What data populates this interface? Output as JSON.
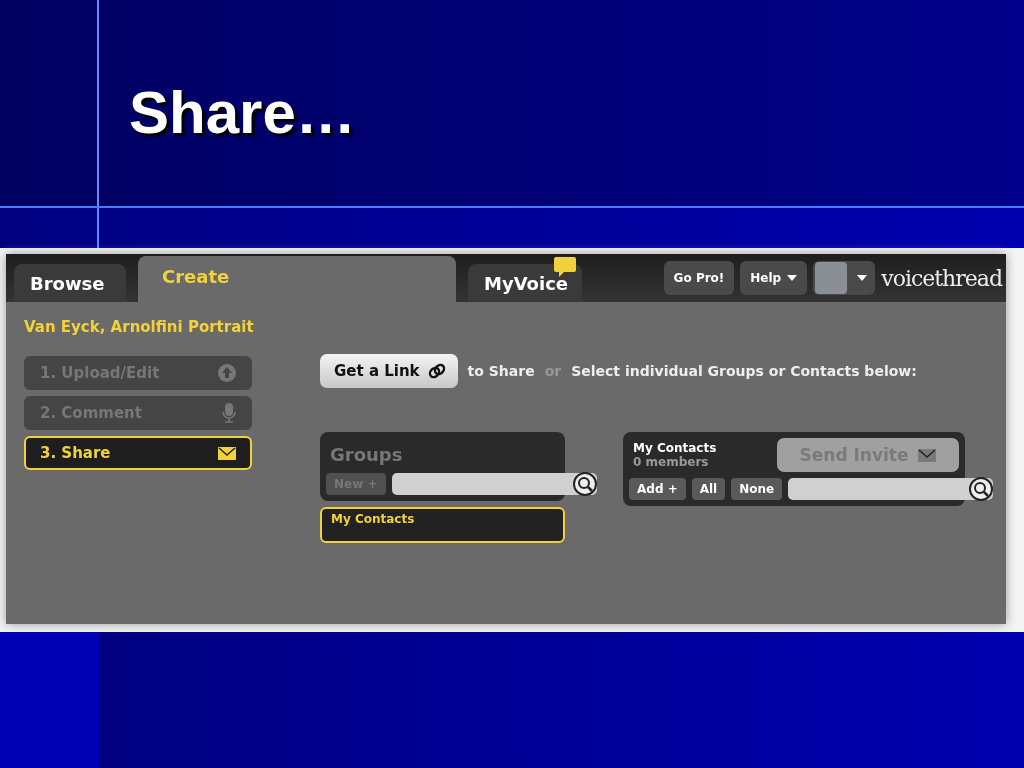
{
  "slide": {
    "title": "Share…"
  },
  "app": {
    "tabs": [
      {
        "label": "Browse",
        "selected": false,
        "notification": false
      },
      {
        "label": "Create",
        "selected": true,
        "notification": false
      },
      {
        "label": "MyVoice",
        "selected": false,
        "notification": true
      }
    ],
    "header_buttons": [
      {
        "label": "Go Pro!",
        "dropdown": false
      },
      {
        "label": "Help",
        "dropdown": true
      }
    ],
    "logo": "voicethread",
    "project_title": "Van Eyck, Arnolfini Portrait",
    "steps": [
      {
        "label": "1. Upload/Edit",
        "kind": "upload",
        "selected": false
      },
      {
        "label": "2. Comment",
        "kind": "microphone",
        "selected": false
      },
      {
        "label": "3. Share",
        "kind": "envelope",
        "selected": true
      }
    ],
    "share_bar": {
      "link_button": "Get a Link",
      "to_share": "to Share",
      "or": "or",
      "instruction": "Select individual Groups or Contacts below:"
    },
    "groups": {
      "title": "Groups",
      "new_button": "New +",
      "new_disabled": true,
      "items": [
        {
          "label": "My Contacts",
          "selected": true
        }
      ]
    },
    "contacts": {
      "title": "My Contacts",
      "count": "0 members",
      "send_button": "Send Invite",
      "send_disabled": true,
      "buttons": [
        "Add +",
        "All",
        "None"
      ]
    }
  }
}
